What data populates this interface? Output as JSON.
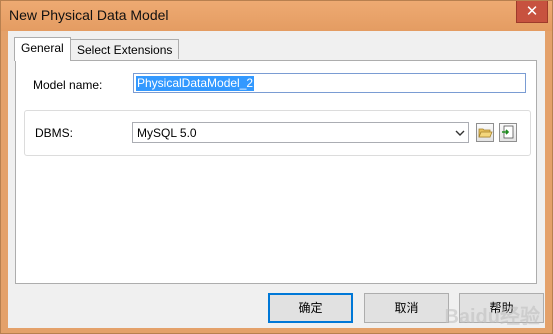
{
  "window": {
    "title": "New Physical Data Model",
    "close_glyph": "✕"
  },
  "tabs": [
    {
      "label": "General",
      "active": true
    },
    {
      "label": "Select Extensions",
      "active": false
    }
  ],
  "general": {
    "model_name_label": "Model name:",
    "model_name_value": "PhysicalDataModel_2",
    "dbms_label": "DBMS:",
    "dbms_value": "MySQL 5.0"
  },
  "buttons": {
    "ok": "确定",
    "cancel": "取消",
    "help": "帮助"
  },
  "watermark": "Baidu经验",
  "colors": {
    "title_bar": "#e4a16a",
    "close_button": "#c7523f",
    "selection": "#3399ff",
    "default_button_border": "#0078d7"
  }
}
